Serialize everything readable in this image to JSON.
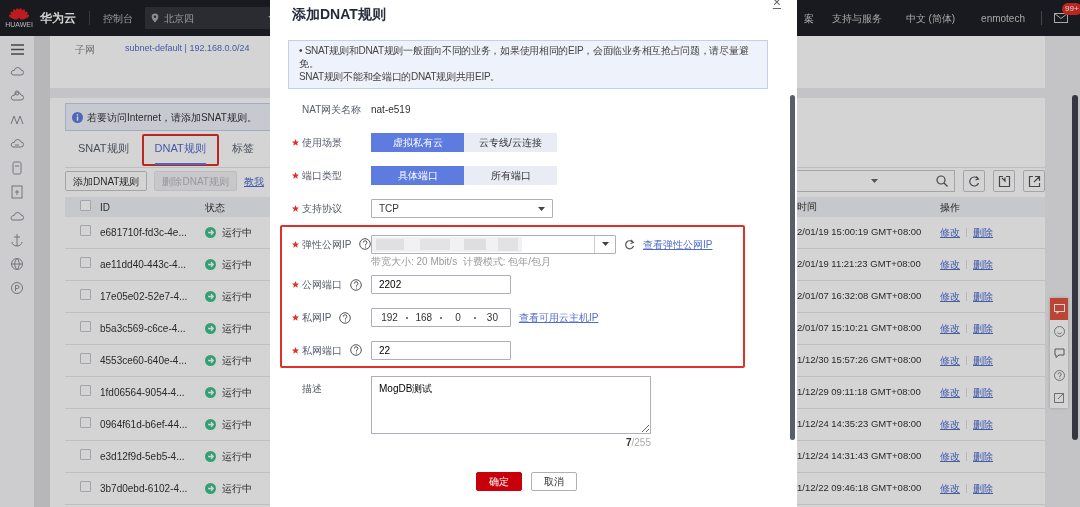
{
  "top_bar": {
    "brand": "HUAWEI",
    "site": "华为云",
    "console": "控制台",
    "region": "北京四",
    "links": [
      "案",
      "支持与服务",
      "中文 (简体)",
      "enmotech"
    ],
    "badge": "99+"
  },
  "subnet": {
    "label": "子网",
    "value": "subnet-default | 192.168.0.0/24"
  },
  "notice": "若要访问Internet，请添加SNAT规则。",
  "tabs": [
    {
      "label": "SNAT规则",
      "selected": false,
      "highlighted": false
    },
    {
      "label": "DNAT规则",
      "selected": true,
      "highlighted": true
    },
    {
      "label": "标签",
      "selected": false,
      "highlighted": false
    }
  ],
  "toolbar": {
    "buttons": [
      {
        "label": "添加DNAT规则",
        "disabled": false
      },
      {
        "label": "删除DNAT规则",
        "disabled": true
      }
    ],
    "link": "教我"
  },
  "table": {
    "columns_left": [
      "ID",
      "状态"
    ],
    "columns_right": [
      "时间",
      "操作"
    ],
    "header_checked": false,
    "rows": [
      {
        "id": "e681710f-fd3c-4e...",
        "status": "运行中",
        "time": "2/01/19 15:00:19 GMT+08:00",
        "actions": [
          "修改",
          "删除"
        ],
        "checked": false
      },
      {
        "id": "ae11dd40-443c-4...",
        "status": "运行中",
        "time": "2/01/19 11:21:23 GMT+08:00",
        "actions": [
          "修改",
          "删除"
        ],
        "checked": false
      },
      {
        "id": "17e05e02-52e7-4...",
        "status": "运行中",
        "time": "2/01/07 16:32:08 GMT+08:00",
        "actions": [
          "修改",
          "删除"
        ],
        "checked": false
      },
      {
        "id": "b5a3c569-c6ce-4...",
        "status": "运行中",
        "time": "2/01/07 15:10:21 GMT+08:00",
        "actions": [
          "修改",
          "删除"
        ],
        "checked": false
      },
      {
        "id": "4553ce60-640e-4...",
        "status": "运行中",
        "time": "1/12/30 15:57:26 GMT+08:00",
        "actions": [
          "修改",
          "删除"
        ],
        "checked": false
      },
      {
        "id": "1fd06564-9054-4...",
        "status": "运行中",
        "time": "1/12/29 09:11:18 GMT+08:00",
        "actions": [
          "修改",
          "删除"
        ],
        "checked": false
      },
      {
        "id": "0964f61d-b6ef-44...",
        "status": "运行中",
        "time": "1/12/24 14:35:23 GMT+08:00",
        "actions": [
          "修改",
          "删除"
        ],
        "checked": false
      },
      {
        "id": "e3d12f9d-5eb5-4...",
        "status": "运行中",
        "time": "1/12/24 14:31:43 GMT+08:00",
        "actions": [
          "修改",
          "删除"
        ],
        "checked": false
      },
      {
        "id": "3b7d0ebd-6102-4...",
        "status": "运行中",
        "time": "1/12/22 09:46:18 GMT+08:00",
        "actions": [
          "修改",
          "删除"
        ],
        "checked": false
      }
    ]
  },
  "dialog": {
    "title": "添加DNAT规则",
    "close": "×",
    "notice": [
      "•  SNAT规则和DNAT规则一般面向不同的业务，如果使用相同的EIP，会面临业务相互抢占问题，请尽量避免。",
      "SNAT规则不能和全端口的DNAT规则共用EIP。"
    ],
    "fields": [
      {
        "kind": "text",
        "label": "NAT网关名称",
        "required": false,
        "help": false,
        "value": "nat-e519"
      },
      {
        "kind": "segmented",
        "label": "使用场景",
        "required": true,
        "help": false,
        "options": [
          {
            "label": "虚拟私有云",
            "selected": true
          },
          {
            "label": "云专线/云连接",
            "selected": false
          }
        ]
      },
      {
        "kind": "segmented",
        "label": "端口类型",
        "required": true,
        "help": false,
        "options": [
          {
            "label": "具体端口",
            "selected": true
          },
          {
            "label": "所有端口",
            "selected": false
          }
        ]
      },
      {
        "kind": "select",
        "label": "支持协议",
        "required": true,
        "help": false,
        "value": "TCP"
      }
    ],
    "highlighted_fields": [
      {
        "kind": "eip",
        "label": "弹性公网IP",
        "required": true,
        "help": true,
        "link": "查看弹性公网IP",
        "hint": "带宽大小: 20 Mbit/s  计费模式: 包年/包月"
      },
      {
        "kind": "input",
        "label": "公网端口",
        "required": true,
        "help": true,
        "value": "2202"
      },
      {
        "kind": "ip",
        "label": "私网IP",
        "required": true,
        "help": true,
        "octets": [
          "192",
          "168",
          "0",
          "30"
        ],
        "link": "查看可用云主机IP"
      },
      {
        "kind": "input",
        "label": "私网端口",
        "required": true,
        "help": true,
        "value": "22"
      }
    ],
    "description": {
      "label": "描述",
      "value": "MogDB测试",
      "count": "7",
      "limit": "/255"
    },
    "buttons": [
      {
        "label": "确定",
        "kind": "primary"
      },
      {
        "label": "取消",
        "kind": "secondary"
      }
    ]
  }
}
